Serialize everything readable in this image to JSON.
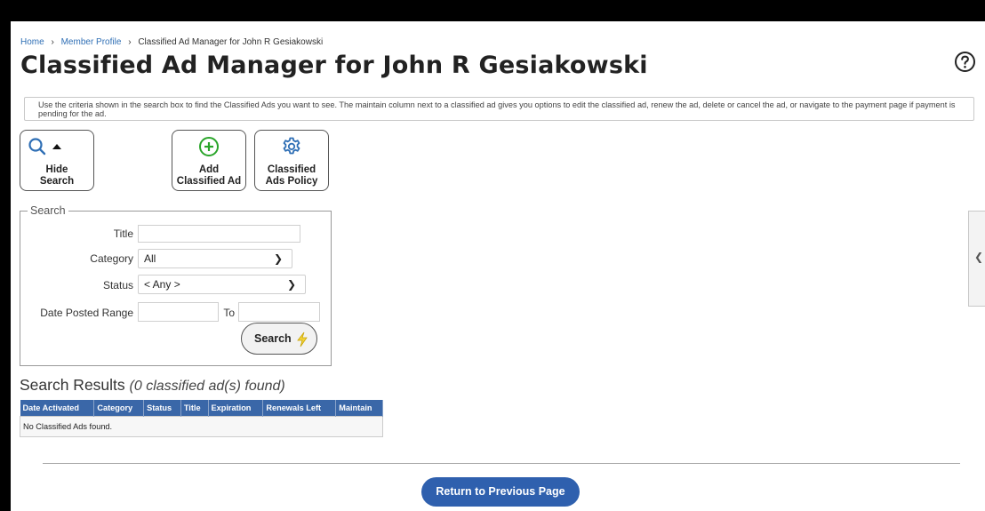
{
  "breadcrumb": {
    "home": "Home",
    "member_profile": "Member Profile",
    "current": "Classified Ad Manager for John R Gesiakowski"
  },
  "page_title": "Classified Ad Manager for John R Gesiakowski",
  "info_text": "Use the criteria shown in the search box to find the Classified Ads you want to see. The maintain column next to a classified ad gives you options to edit the classified ad, renew the ad, delete or cancel the ad, or navigate to the payment page if payment is pending for the ad.",
  "toolbar": {
    "hide_search_line1": "Hide",
    "hide_search_line2": "Search",
    "add_line1": "Add",
    "add_line2": "Classified Ad",
    "policy_line1": "Classified",
    "policy_line2": "Ads Policy"
  },
  "search": {
    "legend": "Search",
    "title_label": "Title",
    "title_value": "",
    "category_label": "Category",
    "category_value": "All",
    "status_label": "Status",
    "status_value": "< Any >",
    "date_label": "Date Posted Range",
    "date_from": "",
    "date_to_label": "To",
    "date_to": "",
    "button_label": "Search"
  },
  "results": {
    "heading": "Search Results",
    "count_text": "(0 classified ad(s) found)",
    "columns": [
      "Date Activated",
      "Category",
      "Status",
      "Title",
      "Expiration",
      "Renewals Left",
      "Maintain"
    ],
    "empty_message": "No Classified Ads found."
  },
  "return_button": "Return to Previous Page",
  "colors": {
    "link": "#2f6fb5",
    "table_header": "#3a67a8",
    "primary_button": "#2f60ae",
    "add_icon": "#2aa52a",
    "search_icon": "#2f6fb5"
  }
}
